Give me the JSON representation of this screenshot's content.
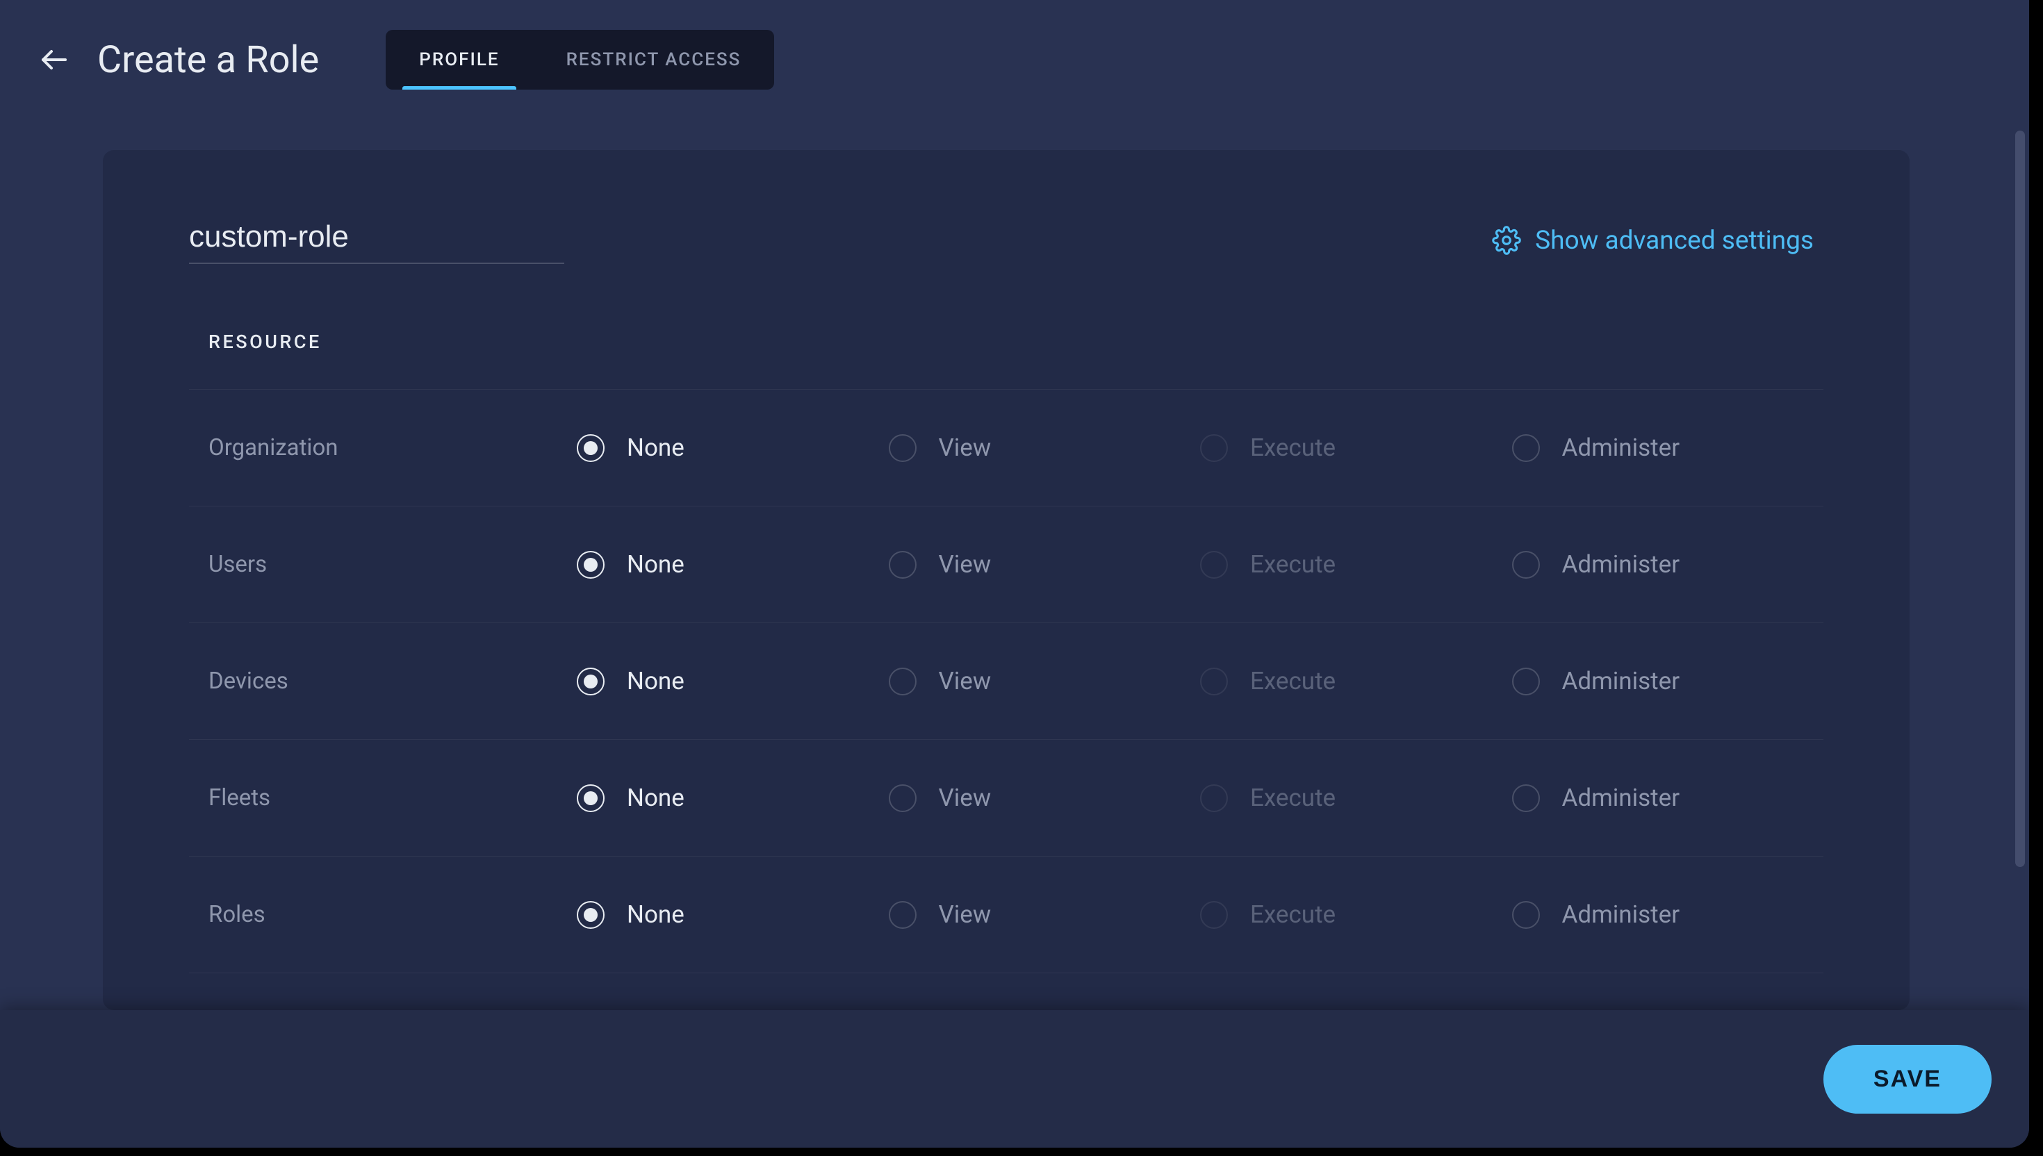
{
  "header": {
    "title": "Create a Role",
    "tabs": [
      {
        "label": "PROFILE",
        "active": true
      },
      {
        "label": "RESTRICT ACCESS",
        "active": false
      }
    ]
  },
  "card": {
    "role_name": "custom-role",
    "advanced_link": "Show advanced settings",
    "column_header": "RESOURCE",
    "permission_options": [
      {
        "key": "none",
        "label": "None",
        "disabled": false
      },
      {
        "key": "view",
        "label": "View",
        "disabled": false
      },
      {
        "key": "execute",
        "label": "Execute",
        "disabled": true
      },
      {
        "key": "administer",
        "label": "Administer",
        "disabled": false
      }
    ],
    "resources": [
      {
        "name": "Organization",
        "selected": "none"
      },
      {
        "name": "Users",
        "selected": "none"
      },
      {
        "name": "Devices",
        "selected": "none"
      },
      {
        "name": "Fleets",
        "selected": "none"
      },
      {
        "name": "Roles",
        "selected": "none"
      }
    ]
  },
  "footer": {
    "save_label": "SAVE"
  },
  "icons": {
    "back": "arrow-left-icon",
    "gear": "gear-icon"
  },
  "colors": {
    "accent": "#4cc4ff",
    "bg_app": "#293252",
    "bg_card": "#222a47"
  }
}
